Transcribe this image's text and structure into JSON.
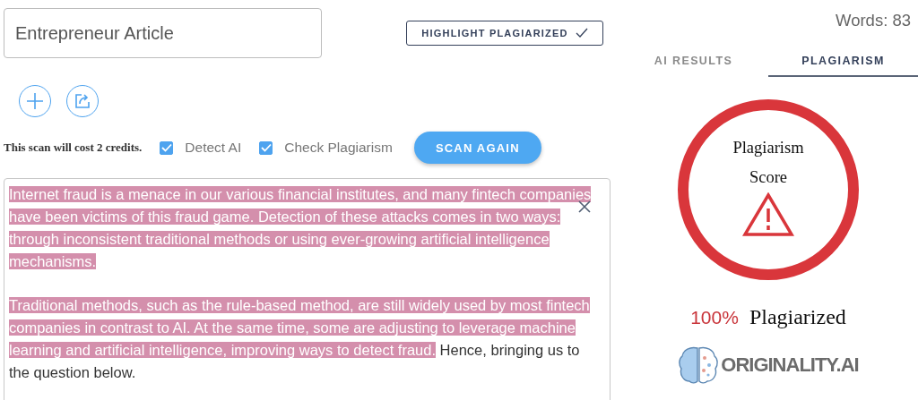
{
  "document": {
    "title": "Entrepreneur Article"
  },
  "highlight_button": {
    "label": "HIGHLIGHT PLAGIARIZED",
    "checked": true
  },
  "scan": {
    "cost": "This scan will cost 2 credits.",
    "options": [
      {
        "label": "Detect AI",
        "checked": true
      },
      {
        "label": "Check Plagiarism",
        "checked": true
      }
    ],
    "button": "SCAN AGAIN"
  },
  "paragraphs": [
    {
      "segments": [
        {
          "text": "Internet fraud is a menace in our various financial institutes, and many fintech companies have been victims of this fraud game. Detection of these attacks comes in two ways: through inconsistent traditional methods or using ever-growing artificial intelligence mechanisms.",
          "highlighted": true
        }
      ]
    },
    {
      "segments": [
        {
          "text": "Traditional methods, such as the rule-based method, are still widely used by most fintech companies in contrast to AI. At the same time, some are adjusting to leverage machine learning and artificial intelligence, improving ways to detect fraud.",
          "highlighted": true
        },
        {
          "text": " Hence, bringing us to the question below.",
          "highlighted": false
        }
      ]
    }
  ],
  "word_count": "Words: 83",
  "tabs": [
    {
      "label": "AI RESULTS",
      "selected": false
    },
    {
      "label": "PLAGIARISM",
      "selected": true
    }
  ],
  "score": {
    "title": "Plagiarism Score",
    "percent": "100%",
    "verdict": "Plagiarized"
  },
  "logo": "ORIGINALITY.AI"
}
